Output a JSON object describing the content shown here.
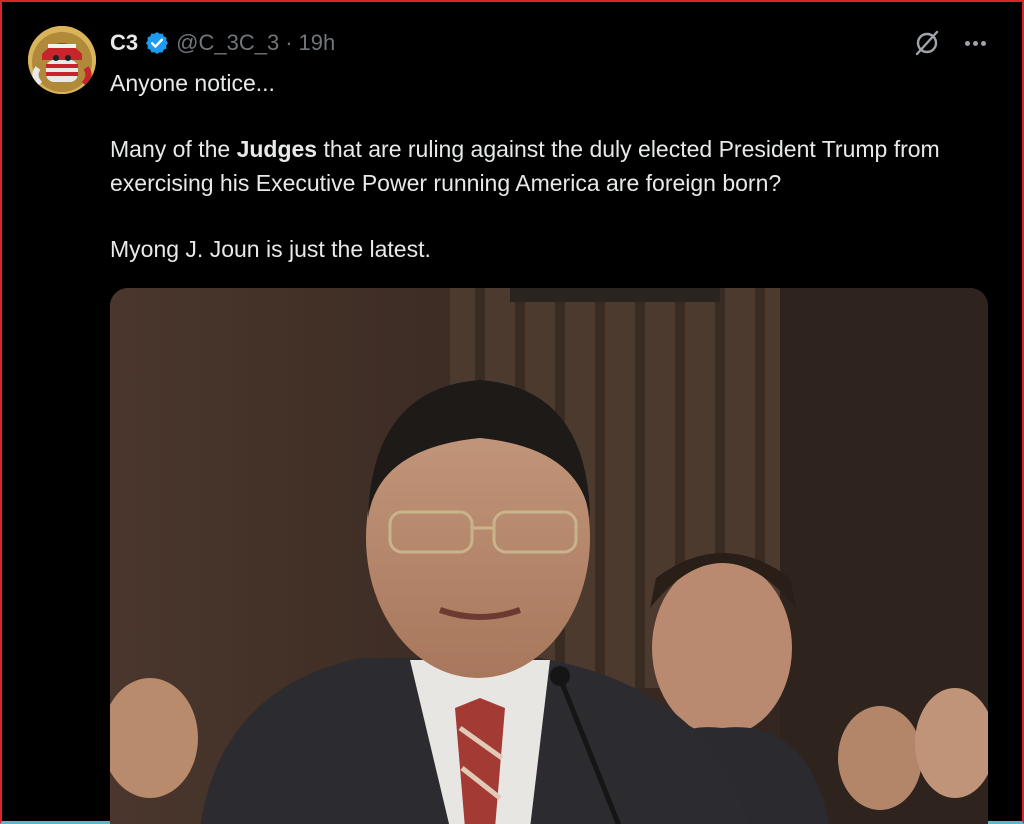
{
  "author": {
    "name": "C3",
    "handle": "@C_3C_3",
    "separator": "·",
    "time": "19h"
  },
  "icons": {
    "avatar": "avatar-image",
    "verified": "verified-badge-icon",
    "grok": "grok-icon",
    "more": "more-icon"
  },
  "colors": {
    "verified": "#1d9bf0",
    "frame_border": "#d7262b",
    "secondary_text": "#71767b"
  },
  "tweet": {
    "line1": "Anyone notice...",
    "para2_pre": "Many of the ",
    "para2_bold": "Judges",
    "para2_post": " that are ruling against the duly elected President Trump from exercising his Executive Power running America are foreign born?",
    "line3": "Myong J. Joun is just the latest."
  },
  "media": {
    "kind": "photo"
  }
}
